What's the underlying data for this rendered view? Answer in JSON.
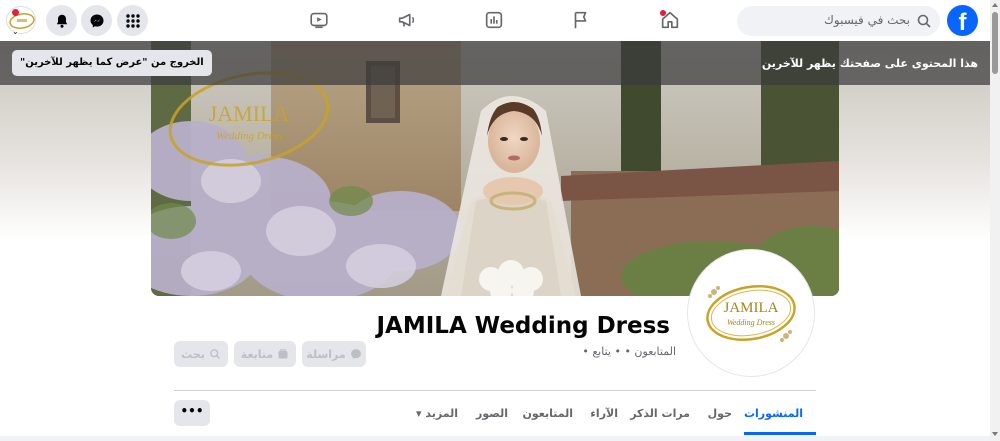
{
  "topbar": {
    "logo_letter": "f",
    "search_placeholder": "بحث في فيسبوك"
  },
  "banner": {
    "message": "هذا المحتوى على صفحتك يظهر للآخرين",
    "exit_label": "الخروج من \"عرض كما يظهر للآخرين\""
  },
  "cover": {
    "watermark_line1": "JAMILA",
    "watermark_line2": "Wedding Dress"
  },
  "profile": {
    "logo_line1": "JAMILA",
    "logo_line2": "Wedding Dress",
    "name": "JAMILA Wedding Dress",
    "followers_text": "المتابعون • • يتابع •"
  },
  "actions": {
    "message_label": "مراسلة",
    "follow_label": "متابعة",
    "search_label": "بحث"
  },
  "tabs": [
    {
      "label": "المنشورات"
    },
    {
      "label": "حول"
    },
    {
      "label": "مرات الذكر"
    },
    {
      "label": "الآراء"
    },
    {
      "label": "المتابعون"
    },
    {
      "label": "الصور"
    },
    {
      "label": "المزيد ▾"
    }
  ],
  "more_label": "•••",
  "colors": {
    "brand_blue": "#0866ff",
    "notification_red": "#e41e3f",
    "gold": "#c9a227"
  }
}
